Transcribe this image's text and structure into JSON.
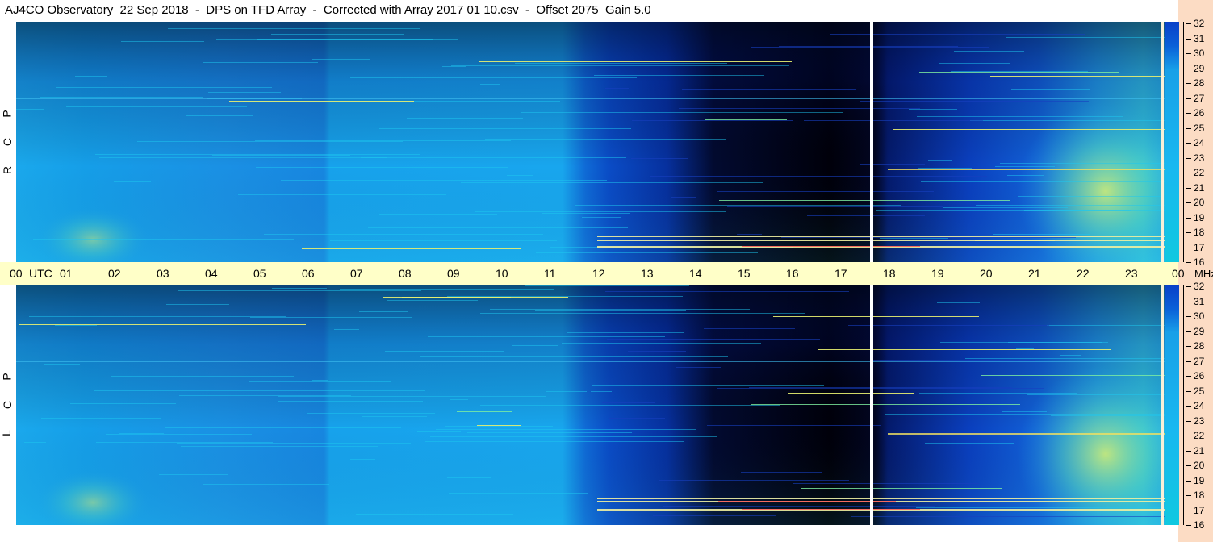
{
  "title": "AJ4CO Observatory  22 Sep 2018  -  DPS on TFD Array  -  Corrected with Array 2017 01 10.csv  -  Offset 2075  Gain 5.0",
  "chart_data": {
    "type": "heatmap",
    "x_axis": {
      "unit": "UTC",
      "tick_labels": [
        "00",
        "UTC",
        "01",
        "02",
        "03",
        "04",
        "05",
        "06",
        "07",
        "08",
        "09",
        "10",
        "11",
        "12",
        "13",
        "14",
        "15",
        "16",
        "17",
        "18",
        "19",
        "20",
        "21",
        "22",
        "23",
        "00"
      ],
      "range": [
        0,
        24
      ]
    },
    "y_axis": {
      "unit": "MHz",
      "tick_labels": [
        "32",
        "31",
        "30",
        "29",
        "28",
        "27",
        "26",
        "25",
        "24",
        "23",
        "22",
        "21",
        "20",
        "19",
        "18",
        "17",
        "16"
      ],
      "range": [
        16,
        32
      ]
    },
    "panels": [
      {
        "label": "R C P"
      },
      {
        "label": "L C P"
      }
    ],
    "color_scale": {
      "low": "#000008",
      "mid": "#0a5ad8",
      "high": "#18b4f0",
      "hot": [
        "#78e678",
        "#f0f064",
        "#ff5050"
      ]
    }
  },
  "labels": {
    "utc_ticks": [
      "00",
      "01",
      "02",
      "03",
      "04",
      "05",
      "06",
      "07",
      "08",
      "09",
      "10",
      "11",
      "12",
      "13",
      "14",
      "15",
      "16",
      "17",
      "18",
      "19",
      "20",
      "21",
      "22",
      "23",
      "00"
    ],
    "utc_word": "UTC",
    "mhz_ticks": [
      "32",
      "31",
      "30",
      "29",
      "28",
      "27",
      "26",
      "25",
      "24",
      "23",
      "22",
      "21",
      "20",
      "19",
      "18",
      "17",
      "16"
    ],
    "mhz_word": "MHz",
    "rcp": [
      "R",
      "C",
      "P"
    ],
    "lcp": [
      "L",
      "C",
      "P"
    ]
  }
}
